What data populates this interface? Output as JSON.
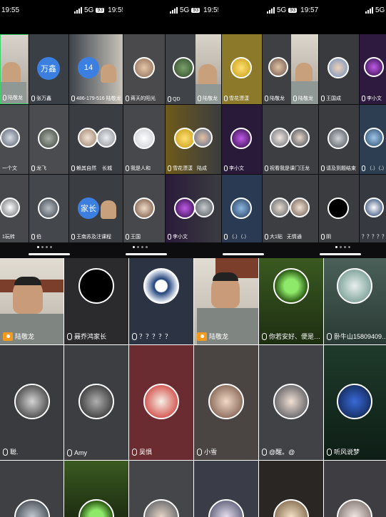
{
  "status_bars": [
    {
      "time": "19:55",
      "net": "",
      "badge": ""
    },
    {
      "time": "19:55",
      "net": "5G",
      "badge": "93"
    },
    {
      "time": "19:55",
      "net": "5G",
      "badge": "93"
    },
    {
      "time": "19:57",
      "net": "5G",
      "badge": "93"
    },
    {
      "time": "",
      "net": "5G",
      "badge": "93"
    }
  ],
  "top_tiles": {
    "r1": [
      "陆敬龙",
      "张万鑫",
      "486-179-516 陆敬龙",
      "蒋天的阳光",
      "QD",
      "陆敬龙",
      "雪花漂漾",
      "陆敬龙",
      "陆敬龙",
      "王国成",
      "李小文"
    ],
    "r2": [
      "一个文",
      "龙飞",
      "赖其自然",
      "长城",
      "我是人和",
      "雪花漂漾",
      "陆成",
      "李小文",
      "祝看我是课门汪龙",
      "请及到题结束",
      "（.）（.）"
    ],
    "r3": [
      "1玩转",
      "伯",
      "王南苏及注课程",
      "王国",
      "李小文",
      "（.）（.）",
      "大1贴",
      "无情通",
      "阴",
      "？？？？？"
    ],
    "badges": {
      "wanxin": "万鑫",
      "num14": "14",
      "parent": "家长"
    }
  },
  "bottom_tiles": [
    {
      "name": "陆敬龙",
      "host": true
    },
    {
      "name": "聂乔鸿家长",
      "host": false
    },
    {
      "name": "？？？？？",
      "host": false
    },
    {
      "name": "陆敬龙",
      "host": true
    },
    {
      "name": "你若安好、便是…",
      "host": false
    },
    {
      "name": "卧牛山15809409…",
      "host": false
    },
    {
      "name": "聪.",
      "host": false
    },
    {
      "name": "Amy",
      "host": false
    },
    {
      "name": "吴惧",
      "host": false
    },
    {
      "name": "小雪",
      "host": false
    },
    {
      "name": "@醒。@",
      "host": false
    },
    {
      "name": "听风说梦",
      "host": false
    }
  ],
  "colors": {
    "host_badge": "#f39a1e",
    "blue_avatar": "#3b7fe0",
    "dark_bg": "#1a1a1a"
  }
}
